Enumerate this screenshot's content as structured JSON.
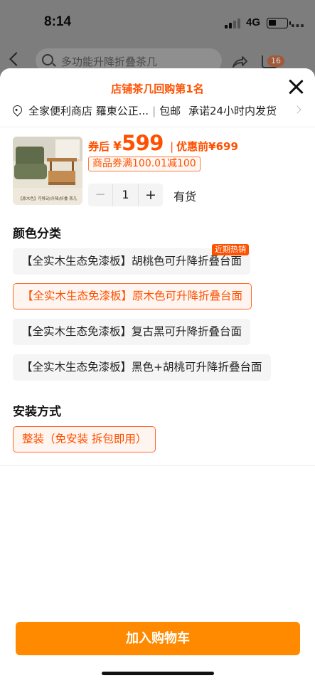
{
  "status_bar": {
    "time": "8:14",
    "network": "4G"
  },
  "background_header": {
    "search_placeholder": "多功能升降折叠茶几",
    "cart_badge": "16"
  },
  "sheet": {
    "title": "店铺茶几回购第1名",
    "address": {
      "location": "全家便利商店 羅東公正...",
      "shipping": "包邮",
      "promise": "承诺24小时内发货"
    },
    "product": {
      "image_caption": "【原木色】可移动/升降/折叠 茶几",
      "price_prefix": "券后",
      "currency": "¥",
      "price": "599",
      "original_label": "优惠前",
      "original_price": "¥699",
      "coupon": "商品券满100.01减100"
    },
    "quantity": {
      "minus": "−",
      "value": "1",
      "plus": "+"
    },
    "stock_status": "有货",
    "color_section": {
      "title": "颜色分类",
      "hot_tag": "近期热销",
      "options": [
        {
          "label": "【全实木生态免漆板】胡桃色可升降折叠台面",
          "selected": false
        },
        {
          "label": "【全实木生态免漆板】原木色可升降折叠台面",
          "selected": true
        },
        {
          "label": "【全实木生态免漆板】复古黑可升降折叠台面",
          "selected": false
        },
        {
          "label": "【全实木生态免漆板】黑色+胡桃可升降折叠台面",
          "selected": false
        }
      ]
    },
    "install_section": {
      "title": "安装方式",
      "options": [
        {
          "label": "整装（免安装 拆包即用）",
          "selected": true
        }
      ]
    },
    "add_to_cart": "加入购物车"
  },
  "colors": {
    "accent": "#ff5000",
    "button": "#ff8a00",
    "selected_bg": "#fff5f0",
    "option_bg": "#f5f5f5"
  }
}
